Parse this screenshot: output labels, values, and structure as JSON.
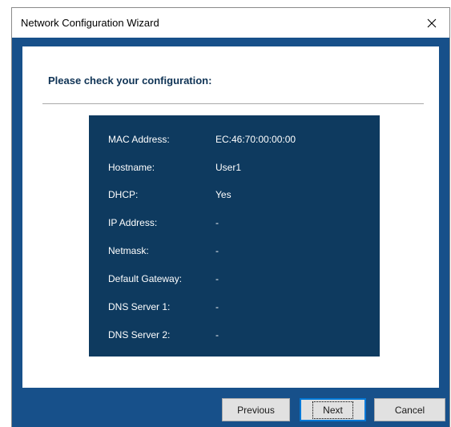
{
  "window": {
    "title": "Network Configuration Wizard"
  },
  "icons": {
    "close": "close-icon"
  },
  "colors": {
    "frame_blue": "#17508a",
    "summary_box": "#0e3a5f",
    "heading_text": "#0f3355",
    "default_button_border": "#0078d7"
  },
  "main": {
    "heading": "Please check your configuration:",
    "config": [
      {
        "label": "MAC Address:",
        "value": "EC:46:70:00:00:00"
      },
      {
        "label": "Hostname:",
        "value": "User1"
      },
      {
        "label": "DHCP:",
        "value": "Yes"
      },
      {
        "label": "IP Address:",
        "value": "-"
      },
      {
        "label": "Netmask:",
        "value": "-"
      },
      {
        "label": "Default Gateway:",
        "value": "-"
      },
      {
        "label": "DNS Server 1:",
        "value": "-"
      },
      {
        "label": "DNS Server 2:",
        "value": "-"
      }
    ]
  },
  "buttons": {
    "previous": "Previous",
    "next": "Next",
    "cancel": "Cancel"
  }
}
